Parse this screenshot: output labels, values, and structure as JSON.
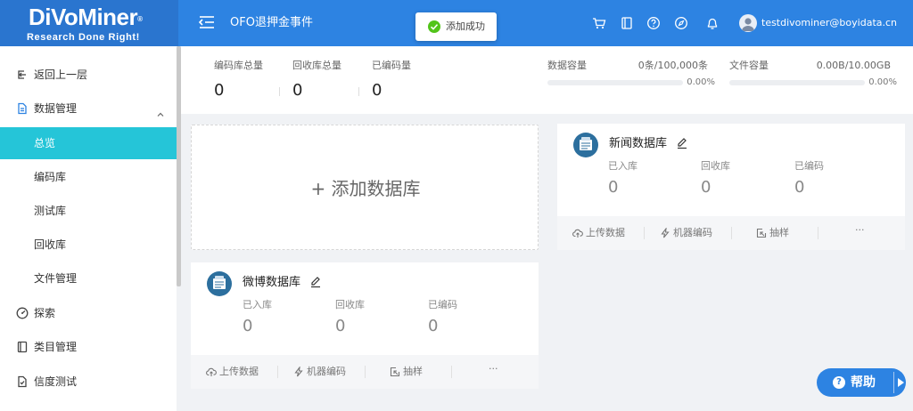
{
  "brand": {
    "name": "DiVoMiner",
    "registered": "®",
    "tagline": "Research Done Right!"
  },
  "header": {
    "project_title": "OFO退押金事件",
    "toast": "添加成功",
    "username": "testdivominer@boyidata.cn",
    "icons": [
      "cart-icon",
      "book-icon",
      "help-circle-icon",
      "compass-icon",
      "bell-icon"
    ]
  },
  "sidebar": {
    "items": [
      {
        "label": "返回上一层",
        "icon": "back-icon"
      },
      {
        "label": "数据管理",
        "icon": "file-icon",
        "expanded": true
      },
      {
        "label": "总览",
        "active": true
      },
      {
        "label": "编码库"
      },
      {
        "label": "测试库"
      },
      {
        "label": "回收库"
      },
      {
        "label": "文件管理"
      },
      {
        "label": "探索",
        "icon": "dashboard-icon"
      },
      {
        "label": "类目管理",
        "icon": "book-icon"
      },
      {
        "label": "信度测试",
        "icon": "reliability-icon"
      }
    ]
  },
  "stats": {
    "coding_total": {
      "label": "编码库总量",
      "value": "0"
    },
    "recycle_total": {
      "label": "回收库总量",
      "value": "0"
    },
    "coded_total": {
      "label": "已编码量",
      "value": "0"
    },
    "data_capacity": {
      "label": "数据容量",
      "value": "0条/100,000条",
      "percent": "0.00%",
      "fraction": 0
    },
    "file_capacity": {
      "label": "文件容量",
      "value": "0.00B/10.00GB",
      "percent": "0.00%",
      "fraction": 0
    }
  },
  "add_database": {
    "label": "+ 添加数据库"
  },
  "cards": [
    {
      "title": "新闻数据库",
      "stats": [
        {
          "label": "已入库",
          "value": "0"
        },
        {
          "label": "回收库",
          "value": "0"
        },
        {
          "label": "已编码",
          "value": "0"
        }
      ],
      "actions": [
        "上传数据",
        "机器编码",
        "抽样",
        "···"
      ]
    },
    {
      "title": "微博数据库",
      "stats": [
        {
          "label": "已入库",
          "value": "0"
        },
        {
          "label": "回收库",
          "value": "0"
        },
        {
          "label": "已编码",
          "value": "0"
        }
      ],
      "actions": [
        "上传数据",
        "机器编码",
        "抽样",
        "···"
      ]
    }
  ],
  "help": {
    "label": "帮助"
  },
  "colors": {
    "header": "#2d83e2",
    "active_menu": "#25c5d8",
    "toast_success": "#52c41a"
  }
}
